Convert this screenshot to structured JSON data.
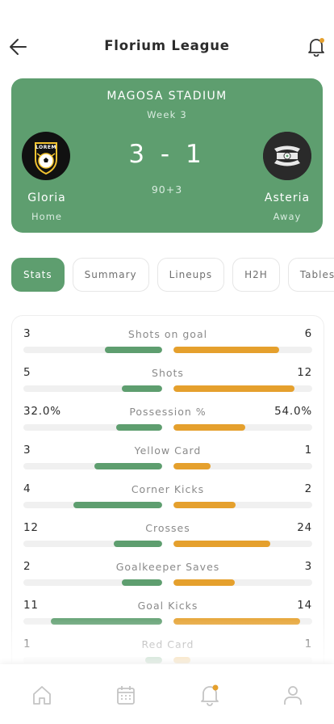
{
  "header": {
    "title": "Florium League",
    "back_icon": "arrow-left-icon",
    "notification_icon": "bell-icon",
    "accent_color": "#e5a02d"
  },
  "match": {
    "stadium": "MAGOSA STADIUM",
    "week": "Week 3",
    "score": "3 - 1",
    "minute": "90+3",
    "home": {
      "name": "Gloria",
      "side": "Home",
      "logo_text": "LOREM"
    },
    "away": {
      "name": "Asteria",
      "side": "Away"
    },
    "card_color": "#5e9e6f"
  },
  "tabs": [
    {
      "label": "Stats",
      "active": true
    },
    {
      "label": "Summary",
      "active": false
    },
    {
      "label": "Lineups",
      "active": false
    },
    {
      "label": "H2H",
      "active": false
    },
    {
      "label": "Tables",
      "active": false
    }
  ],
  "stats": [
    {
      "label": "Shots on goal",
      "home": "3",
      "away": "6",
      "home_fill": 0.41,
      "away_fill": 0.76
    },
    {
      "label": "Shots",
      "home": "5",
      "away": "12",
      "home_fill": 0.29,
      "away_fill": 0.87
    },
    {
      "label": "Possession %",
      "home": "32.0%",
      "away": "54.0%",
      "home_fill": 0.33,
      "away_fill": 0.52
    },
    {
      "label": "Yellow Card",
      "home": "3",
      "away": "1",
      "home_fill": 0.49,
      "away_fill": 0.27
    },
    {
      "label": "Corner Kicks",
      "home": "4",
      "away": "2",
      "home_fill": 0.64,
      "away_fill": 0.45
    },
    {
      "label": "Crosses",
      "home": "12",
      "away": "24",
      "home_fill": 0.35,
      "away_fill": 0.7
    },
    {
      "label": "Goalkeeper Saves",
      "home": "2",
      "away": "3",
      "home_fill": 0.29,
      "away_fill": 0.44
    },
    {
      "label": "Goal Kicks",
      "home": "11",
      "away": "14",
      "home_fill": 0.8,
      "away_fill": 0.91
    },
    {
      "label": "Red Card",
      "home": "1",
      "away": "1",
      "home_fill": 0.12,
      "away_fill": 0.12
    }
  ],
  "bottom_nav": [
    {
      "icon": "home-icon"
    },
    {
      "icon": "calendar-icon"
    },
    {
      "icon": "bell-icon",
      "active": true
    },
    {
      "icon": "user-icon"
    }
  ]
}
